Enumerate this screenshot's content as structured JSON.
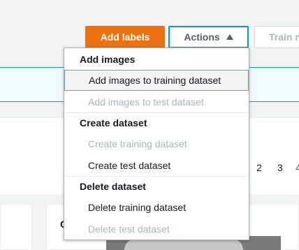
{
  "toolbar": {
    "add_labels_label": "Add labels",
    "actions_label": "Actions",
    "train_label": "Train m",
    "accent_color": "#ec7211",
    "focus_color": "#00a1c9"
  },
  "pagination": {
    "pages": [
      "2",
      "3",
      "4"
    ]
  },
  "card": {
    "letter": "C"
  },
  "menu": {
    "groups": [
      {
        "title": "Add images",
        "items": [
          {
            "label": "Add images to training dataset",
            "enabled": true,
            "highlighted": true
          },
          {
            "label": "Add images to test dataset",
            "enabled": false
          }
        ]
      },
      {
        "title": "Create dataset",
        "items": [
          {
            "label": "Create training dataset",
            "enabled": false
          },
          {
            "label": "Create test dataset",
            "enabled": true
          }
        ]
      },
      {
        "title": "Delete dataset",
        "items": [
          {
            "label": "Delete training dataset",
            "enabled": true
          },
          {
            "label": "Delete test dataset",
            "enabled": false
          }
        ]
      }
    ]
  }
}
